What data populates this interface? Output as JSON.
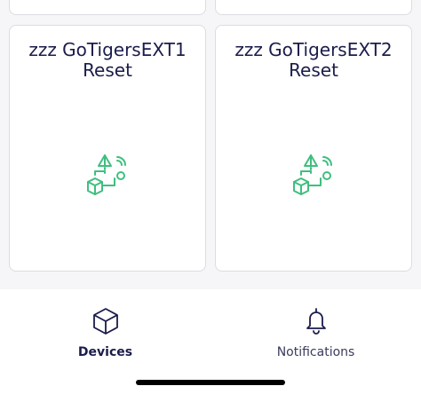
{
  "devices": [
    {
      "name": "zzz GoTigersEXT1\nReset",
      "icon": "network-devices-icon"
    },
    {
      "name": "zzz GoTigersEXT2\nReset",
      "icon": "network-devices-icon"
    }
  ],
  "tabbar": {
    "tabs": [
      {
        "label": "Devices",
        "icon": "cube-icon",
        "active": true
      },
      {
        "label": "Notifications",
        "icon": "bell-icon",
        "active": false
      }
    ]
  },
  "colors": {
    "title": "#1b1c4b",
    "accent_green": "#3fbf7f",
    "background": "#f6f6f8",
    "card_border": "#dcdce2"
  }
}
